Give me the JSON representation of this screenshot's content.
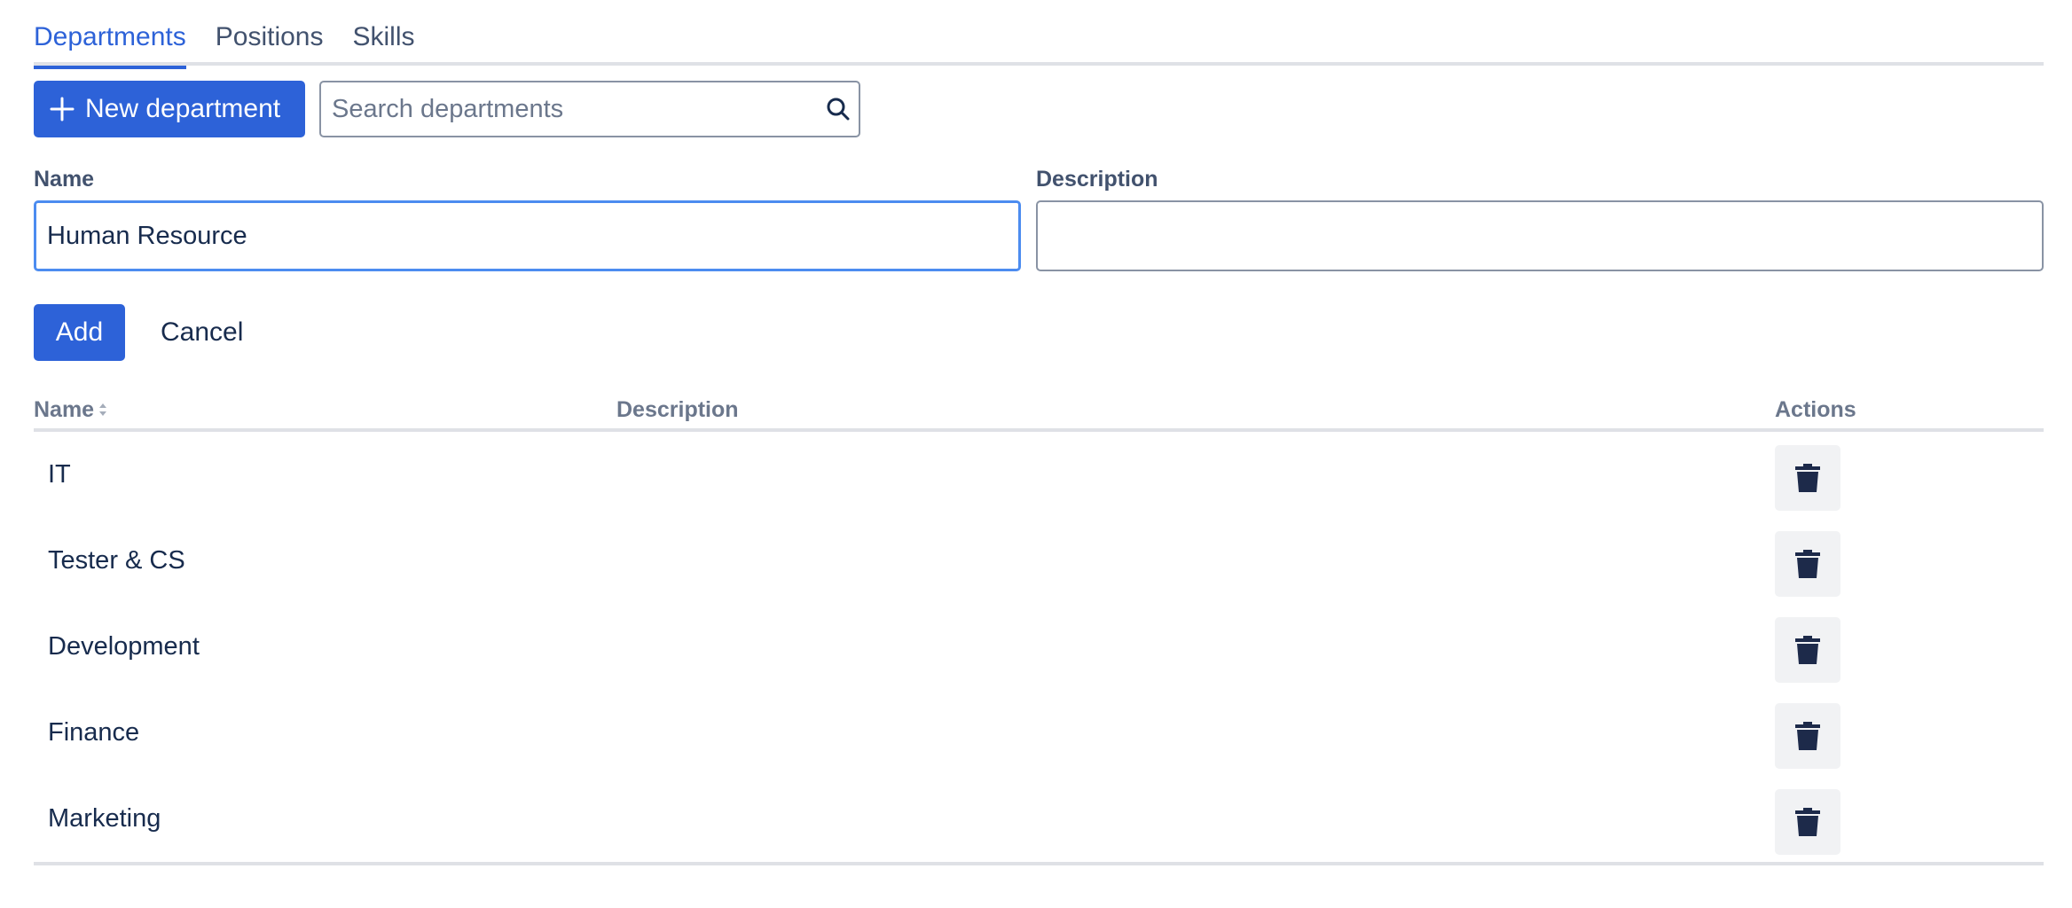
{
  "tabs": [
    {
      "label": "Departments",
      "active": true
    },
    {
      "label": "Positions",
      "active": false
    },
    {
      "label": "Skills",
      "active": false
    }
  ],
  "toolbar": {
    "new_button_label": "New department",
    "search_placeholder": "Search departments",
    "search_value": ""
  },
  "form": {
    "name_label": "Name",
    "name_value": "Human Resource",
    "description_label": "Description",
    "description_value": "",
    "add_label": "Add",
    "cancel_label": "Cancel"
  },
  "table": {
    "columns": {
      "name": "Name",
      "description": "Description",
      "actions": "Actions"
    },
    "rows": [
      {
        "name": "IT",
        "description": ""
      },
      {
        "name": "Tester & CS",
        "description": ""
      },
      {
        "name": "Development",
        "description": ""
      },
      {
        "name": "Finance",
        "description": ""
      },
      {
        "name": "Marketing",
        "description": ""
      }
    ]
  },
  "colors": {
    "accent": "#2d62d8",
    "focus_border": "#4c8cf0",
    "text": "#172b4d",
    "muted": "#6b778c",
    "divider": "#dfe1e6",
    "icon_dark": "#1d2a4a"
  },
  "icons": {
    "new": "plus-icon",
    "search": "search-icon",
    "sort": "sort-icon",
    "delete": "trash-icon"
  }
}
